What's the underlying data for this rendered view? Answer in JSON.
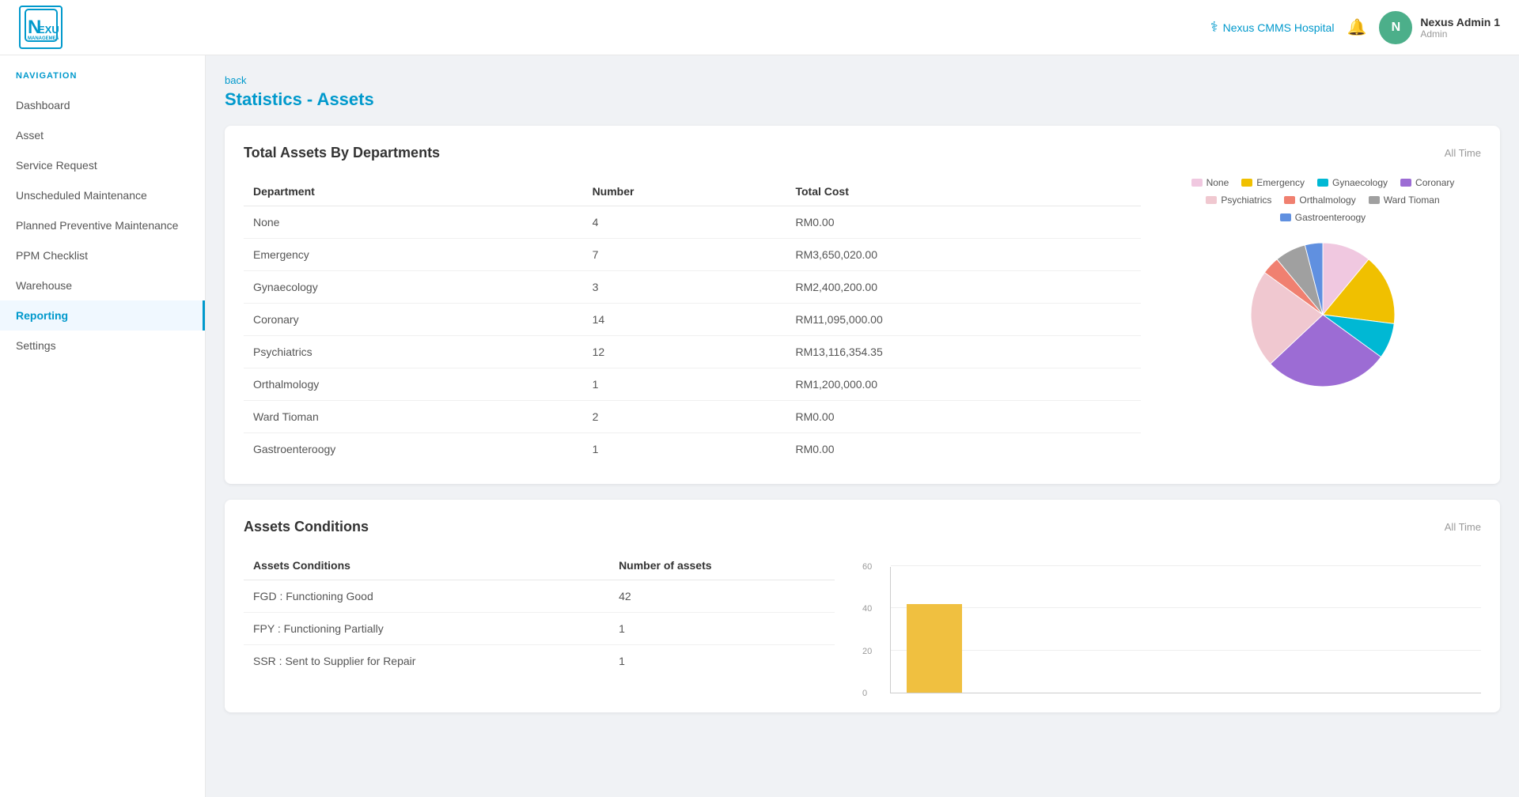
{
  "header": {
    "logo_text": "NEXUS",
    "hospital_name": "Nexus CMMS Hospital",
    "user_name": "Nexus Admin 1",
    "user_role": "Admin",
    "avatar_initials": "N"
  },
  "nav": {
    "label": "NAVIGATION",
    "items": [
      {
        "id": "dashboard",
        "label": "Dashboard",
        "active": false
      },
      {
        "id": "asset",
        "label": "Asset",
        "active": false
      },
      {
        "id": "service-request",
        "label": "Service Request",
        "active": false
      },
      {
        "id": "unscheduled-maintenance",
        "label": "Unscheduled Maintenance",
        "active": false
      },
      {
        "id": "planned-preventive-maintenance",
        "label": "Planned Preventive Maintenance",
        "active": false
      },
      {
        "id": "ppm-checklist",
        "label": "PPM Checklist",
        "active": false
      },
      {
        "id": "warehouse",
        "label": "Warehouse",
        "active": false
      },
      {
        "id": "reporting",
        "label": "Reporting",
        "active": true
      },
      {
        "id": "settings",
        "label": "Settings",
        "active": false
      }
    ]
  },
  "page": {
    "back_label": "back",
    "title": "Statistics - Assets"
  },
  "total_assets_card": {
    "title": "Total Assets By Departments",
    "badge": "All Time",
    "columns": [
      "Department",
      "Number",
      "Total Cost"
    ],
    "rows": [
      {
        "department": "None",
        "number": "4",
        "total_cost": "RM0.00"
      },
      {
        "department": "Emergency",
        "number": "7",
        "total_cost": "RM3,650,020.00"
      },
      {
        "department": "Gynaecology",
        "number": "3",
        "total_cost": "RM2,400,200.00"
      },
      {
        "department": "Coronary",
        "number": "14",
        "total_cost": "RM11,095,000.00"
      },
      {
        "department": "Psychiatrics",
        "number": "12",
        "total_cost": "RM13,116,354.35"
      },
      {
        "department": "Orthalmology",
        "number": "1",
        "total_cost": "RM1,200,000.00"
      },
      {
        "department": "Ward Tioman",
        "number": "2",
        "total_cost": "RM0.00"
      },
      {
        "department": "Gastroenteroogy",
        "number": "1",
        "total_cost": "RM0.00"
      }
    ],
    "legend": [
      {
        "label": "None",
        "color": "#f0c8e0"
      },
      {
        "label": "Emergency",
        "color": "#f0c000"
      },
      {
        "label": "Gynaecology",
        "color": "#00b8d4"
      },
      {
        "label": "Coronary",
        "color": "#9c6cd4"
      },
      {
        "label": "Psychiatrics",
        "color": "#f0c8d0"
      },
      {
        "label": "Orthalmology",
        "color": "#f08070"
      },
      {
        "label": "Ward Tioman",
        "color": "#a0a0a0"
      },
      {
        "label": "Gastroenteroogy",
        "color": "#6090e0"
      }
    ],
    "pie_data": [
      {
        "label": "None",
        "color": "#f0c8e0",
        "percent": 11
      },
      {
        "label": "Emergency",
        "color": "#f0c000",
        "percent": 16
      },
      {
        "label": "Gynaecology",
        "color": "#00b8d4",
        "percent": 8
      },
      {
        "label": "Coronary",
        "color": "#9c6cd4",
        "percent": 28
      },
      {
        "label": "Psychiatrics",
        "color": "#f0c8d0",
        "percent": 22
      },
      {
        "label": "Orthalmology",
        "color": "#f08070",
        "percent": 4
      },
      {
        "label": "Ward Tioman",
        "color": "#a0a0a0",
        "percent": 7
      },
      {
        "label": "Gastroenteroogy",
        "color": "#6090e0",
        "percent": 4
      }
    ]
  },
  "assets_conditions_card": {
    "title": "Assets Conditions",
    "badge": "All Time",
    "columns": [
      "Assets Conditions",
      "Number of assets"
    ],
    "rows": [
      {
        "condition": "FGD : Functioning Good",
        "count": "42"
      },
      {
        "condition": "FPY : Functioning Partially",
        "count": "1"
      },
      {
        "condition": "SSR : Sent to Supplier for Repair",
        "count": "1"
      }
    ],
    "bar_y_ticks": [
      "60",
      "40",
      "20",
      "0"
    ],
    "bar_value": 42,
    "bar_max": 60
  }
}
